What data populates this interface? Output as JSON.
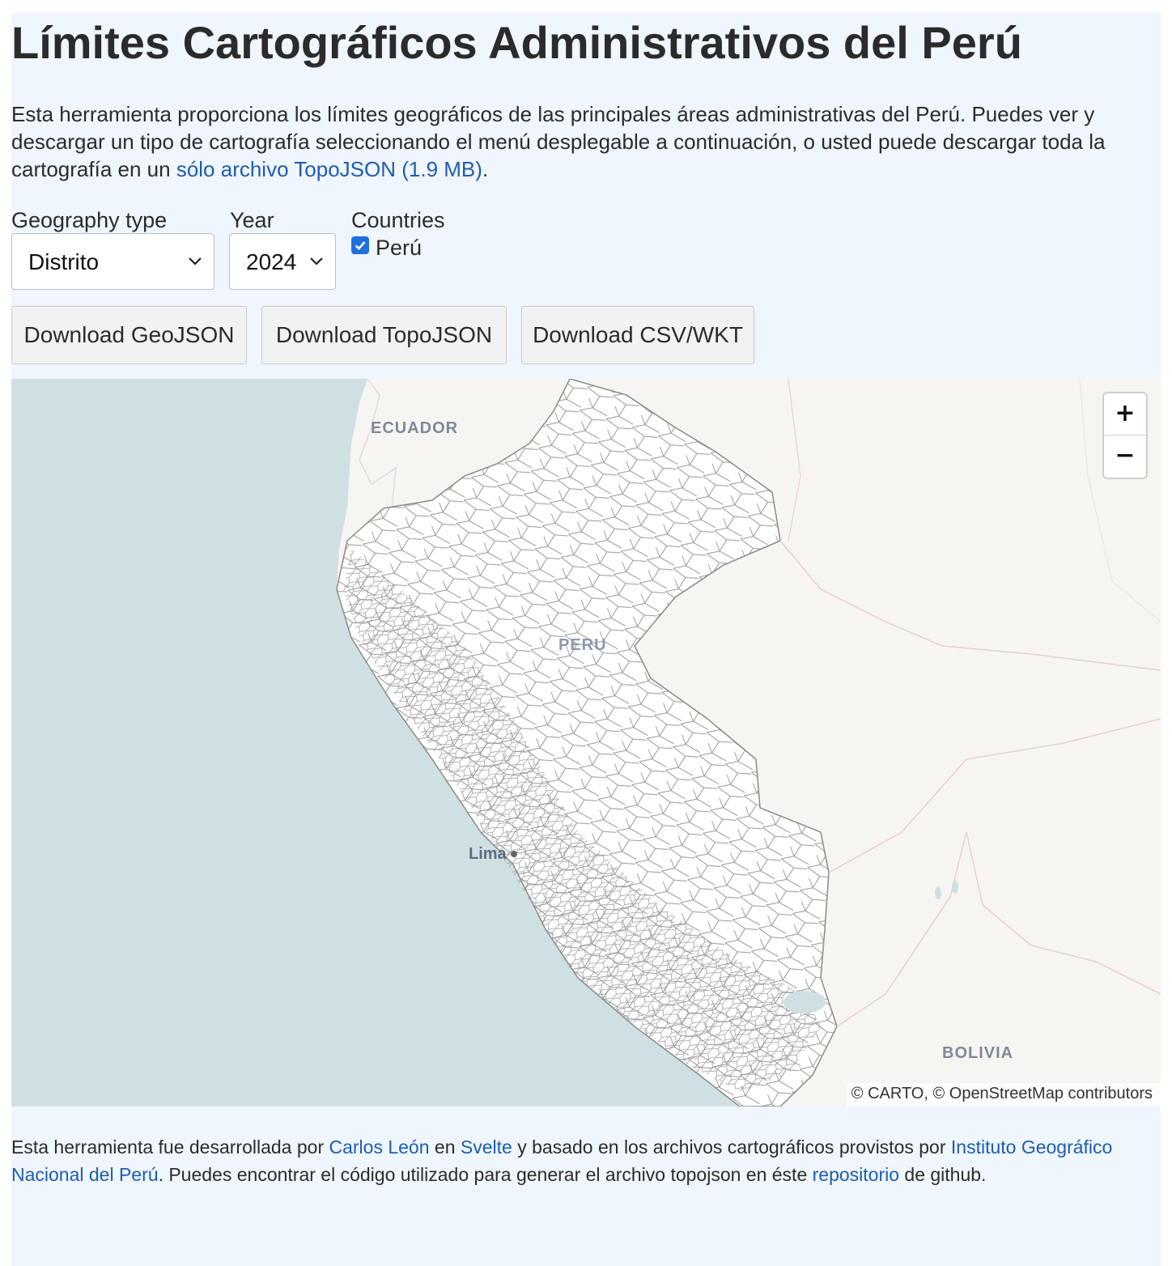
{
  "title": "Límites Cartográficos Administrativos del Perú",
  "intro": {
    "text_before": "Esta herramienta proporciona los límites geográficos de las principales áreas administrativas del Perú. Puedes ver y descargar un tipo de cartografía seleccionando el menú desplegable a continuación, o usted puede descargar toda la cartografía en un ",
    "link": "sólo archivo TopoJSON (1.9 MB)",
    "text_after": "."
  },
  "controls": {
    "geography_label": "Geography type",
    "geography_value": "Distrito",
    "year_label": "Year",
    "year_value": "2024",
    "countries_label": "Countries",
    "country_option": "Perú",
    "country_checked": true
  },
  "buttons": {
    "geojson": "Download GeoJSON",
    "topojson": "Download TopoJSON",
    "csv": "Download CSV/WKT"
  },
  "map": {
    "labels": {
      "ecuador": "ECUADOR",
      "peru": "PERU",
      "lima": "Lima",
      "bolivia": "BOLIVIA"
    },
    "zoom_in": "+",
    "zoom_out": "−",
    "attribution": "© CARTO, © OpenStreetMap contributors",
    "colors": {
      "ocean": "#cfe0e3",
      "land": "#f7f5f2",
      "boundary": "#8a8a8a",
      "country_fill": "#ffffff"
    }
  },
  "footer": {
    "t1": "Esta herramienta fue desarrollada por ",
    "author_link": "Carlos León",
    "t2": " en ",
    "svelte_link": "Svelte",
    "t3": " y basado en los archivos cartográficos provistos por ",
    "ign_link": "Instituto Geográfico Nacional del Perú",
    "t4": ". Puedes encontrar el código utilizado para generar el archivo topojson en éste ",
    "repo_link": "repositorio",
    "t5": " de github."
  }
}
